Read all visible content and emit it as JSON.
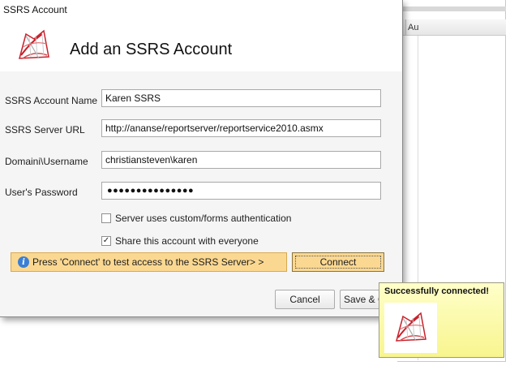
{
  "background_window": {
    "column_header_label": "Au"
  },
  "dialog": {
    "window_title": "SSRS Account",
    "heading": "Add an SSRS Account",
    "fields": {
      "account_name": {
        "label": "SSRS Account Name",
        "value": "Karen SSRS"
      },
      "server_url": {
        "label": "SSRS Server URL",
        "value": "http://ananse/reportserver/reportservice2010.asmx"
      },
      "domain_username": {
        "label": "Domaini\\Username",
        "value": "christiansteven\\karen"
      },
      "password": {
        "label": "User's Password",
        "masked_value": "●●●●●●●●●●●●●●●"
      }
    },
    "checkboxes": {
      "custom_auth": {
        "label": "Server uses custom/forms authentication",
        "checked": false
      },
      "share_account": {
        "label": "Share this account with everyone",
        "checked": true,
        "check_mark": "✓"
      }
    },
    "info_bar": {
      "icon_glyph": "i",
      "text": "Press 'Connect' to test access to the SSRS Server> >"
    },
    "buttons": {
      "connect": "Connect",
      "cancel": "Cancel",
      "save_close": "Save & C"
    }
  },
  "toast": {
    "title": "Successfully connected!"
  },
  "colors": {
    "info_bar_bg": "#fbd891",
    "toast_bg": "#f8f58f",
    "ssrs_icon_red": "#c8202a"
  },
  "icons": {
    "dialog_icon": "ssrs-logo-icon",
    "toast_icon": "ssrs-logo-icon",
    "info_icon": "info-icon"
  }
}
